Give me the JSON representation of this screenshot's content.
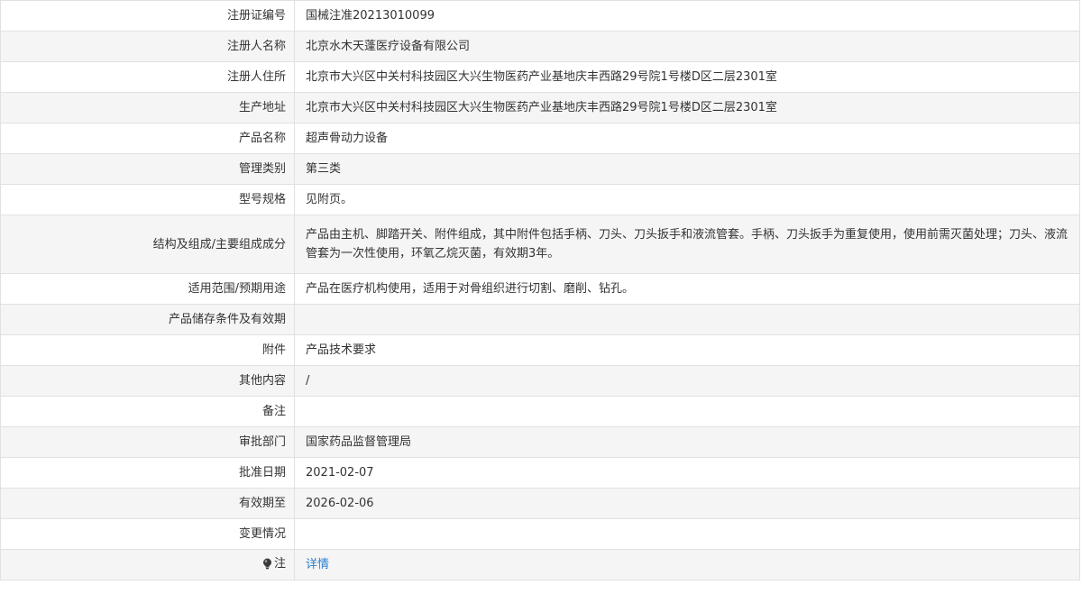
{
  "rows": [
    {
      "label": "注册证编号",
      "value": "国械注准20213010099"
    },
    {
      "label": "注册人名称",
      "value": "北京水木天蓬医疗设备有限公司"
    },
    {
      "label": "注册人住所",
      "value": "北京市大兴区中关村科技园区大兴生物医药产业基地庆丰西路29号院1号楼D区二层2301室"
    },
    {
      "label": "生产地址",
      "value": "北京市大兴区中关村科技园区大兴生物医药产业基地庆丰西路29号院1号楼D区二层2301室"
    },
    {
      "label": "产品名称",
      "value": "超声骨动力设备"
    },
    {
      "label": "管理类别",
      "value": "第三类"
    },
    {
      "label": "型号规格",
      "value": "见附页。"
    },
    {
      "label": "结构及组成/主要组成成分",
      "value": "产品由主机、脚踏开关、附件组成，其中附件包括手柄、刀头、刀头扳手和液流管套。手柄、刀头扳手为重复使用，使用前需灭菌处理；刀头、液流管套为一次性使用，环氧乙烷灭菌，有效期3年。"
    },
    {
      "label": "适用范围/预期用途",
      "value": "产品在医疗机构使用，适用于对骨组织进行切割、磨削、钻孔。"
    },
    {
      "label": "产品储存条件及有效期",
      "value": ""
    },
    {
      "label": "附件",
      "value": "产品技术要求"
    },
    {
      "label": "其他内容",
      "value": "/"
    },
    {
      "label": "备注",
      "value": ""
    },
    {
      "label": "审批部门",
      "value": "国家药品监督管理局"
    },
    {
      "label": "批准日期",
      "value": "2021-02-07"
    },
    {
      "label": "有效期至",
      "value": "2026-02-06"
    },
    {
      "label": "变更情况",
      "value": ""
    }
  ],
  "note": {
    "label": "注",
    "link_text": "详情",
    "icon": "bulb-icon"
  },
  "colors": {
    "border": "#e1e1e1",
    "stripe": "#f5f5f5",
    "text": "#333333",
    "link": "#2a7fd1"
  }
}
